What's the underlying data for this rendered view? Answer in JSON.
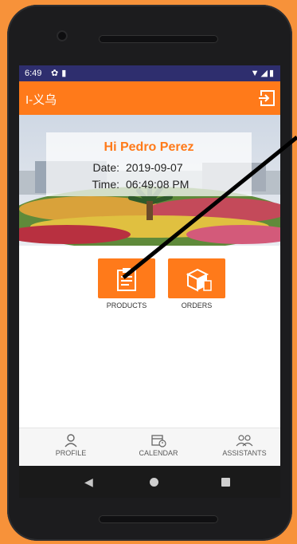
{
  "status_bar": {
    "time": "6:49",
    "left_icons": [
      "gear-icon",
      "sim-card-icon"
    ],
    "right_icons": [
      "wifi-icon",
      "signal-icon",
      "battery-icon"
    ]
  },
  "app_bar": {
    "title": "I-义乌",
    "action_icon": "exit-icon"
  },
  "greeting": {
    "hi_text": "Hi Pedro Perez",
    "date_label": "Date:",
    "date_value": "2019-09-07",
    "time_label": "Time:",
    "time_value": "06:49:08 PM"
  },
  "tiles": [
    {
      "label": "PRODUCTS",
      "icon": "clipboard-icon"
    },
    {
      "label": "ORDERS",
      "icon": "boxes-icon"
    }
  ],
  "bottom_nav": [
    {
      "label": "PROFILE",
      "icon": "person-icon"
    },
    {
      "label": "CALENDAR",
      "icon": "calendar-icon"
    },
    {
      "label": "ASSISTANTS",
      "icon": "group-icon"
    }
  ],
  "colors": {
    "accent": "#ff7a1a",
    "status_bar": "#2e2e6e",
    "background": "#f7923a"
  }
}
